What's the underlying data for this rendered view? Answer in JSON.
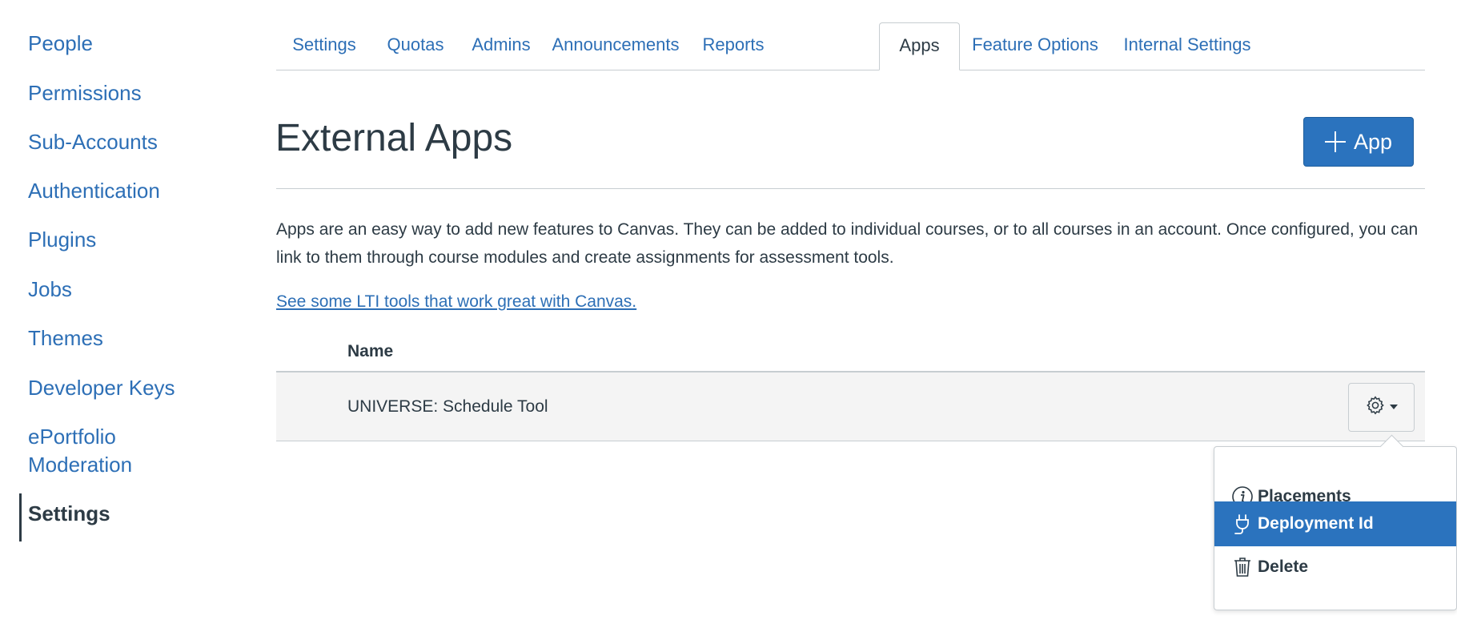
{
  "sidebar": {
    "items": [
      {
        "label": "People"
      },
      {
        "label": "Permissions"
      },
      {
        "label": "Sub-Accounts"
      },
      {
        "label": "Authentication"
      },
      {
        "label": "Plugins"
      },
      {
        "label": "Jobs"
      },
      {
        "label": "Themes"
      },
      {
        "label": "Developer Keys"
      },
      {
        "label": "ePortfolio"
      },
      {
        "label": "Moderation"
      },
      {
        "label": "Settings"
      }
    ],
    "active": "Settings"
  },
  "tabs": [
    {
      "label": "Settings"
    },
    {
      "label": "Quotas"
    },
    {
      "label": "Admins"
    },
    {
      "label": "Announcements"
    },
    {
      "label": "Reports"
    },
    {
      "label": "Apps"
    },
    {
      "label": "Feature Options"
    },
    {
      "label": "Internal Settings"
    }
  ],
  "active_tab": "Apps",
  "header": {
    "title": "External Apps",
    "add_button_label": "App"
  },
  "intro": {
    "text": "Apps are an easy way to add new features to Canvas. They can be added to individual courses, or to all courses in an account. Once configured, you can link to them through course modules and create assignments for assessment tools.",
    "link": "See some LTI tools that work great with Canvas."
  },
  "table": {
    "columns": [
      "Name"
    ],
    "rows": [
      {
        "name": "UNIVERSE: Schedule Tool"
      }
    ]
  },
  "menu": {
    "items": [
      {
        "label": "Placements",
        "icon": "info-icon"
      },
      {
        "label": "Deployment Id",
        "icon": "plug-icon"
      },
      {
        "label": "Delete",
        "icon": "trash-icon"
      }
    ],
    "highlighted": "Deployment Id"
  },
  "colors": {
    "link": "#2d6fb6",
    "primary_button": "#2b73be",
    "text": "#2d3b45",
    "row_background": "#f4f4f4"
  }
}
